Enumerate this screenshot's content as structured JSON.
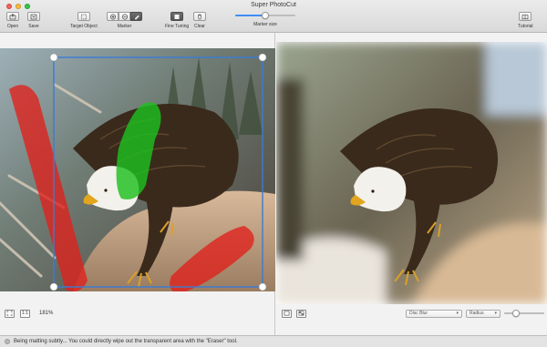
{
  "window": {
    "title": "Super PhotoCut",
    "lights": [
      "#fc5f57",
      "#fdbc2e",
      "#33c748"
    ]
  },
  "toolbar": {
    "open_label": "Open",
    "save_label": "Save",
    "target_object_label": "Target Object",
    "marker_label": "Marker",
    "marker_tools": [
      "keep-marker",
      "remove-marker",
      "eraser"
    ],
    "active_marker_tool": "eraser",
    "fine_tuning_label": "Fine Tuning",
    "clear_label": "Clear",
    "marker_size_label": "Marker size",
    "marker_size_value": 0.5,
    "tutorial_label": "Tutorial"
  },
  "canvas": {
    "selection_color": "#3b7bd6",
    "keep_stroke_color": "#1fbf1f",
    "remove_stroke_color": "#e0201b"
  },
  "left_footer": {
    "fit_icon": "fit-screen-icon",
    "actual_size_label": "1:1",
    "zoom_label": "181%"
  },
  "right_footer": {
    "background_icon": "background-icon",
    "checker_icon": "checkerboard-icon",
    "blur_select": "Disc Blur",
    "radius_select": "Radius",
    "radius_value": 0.3
  },
  "status": {
    "message": "Being matting subtly... You could directly wipe out the transparent area with the \"Eraser\" tool."
  }
}
